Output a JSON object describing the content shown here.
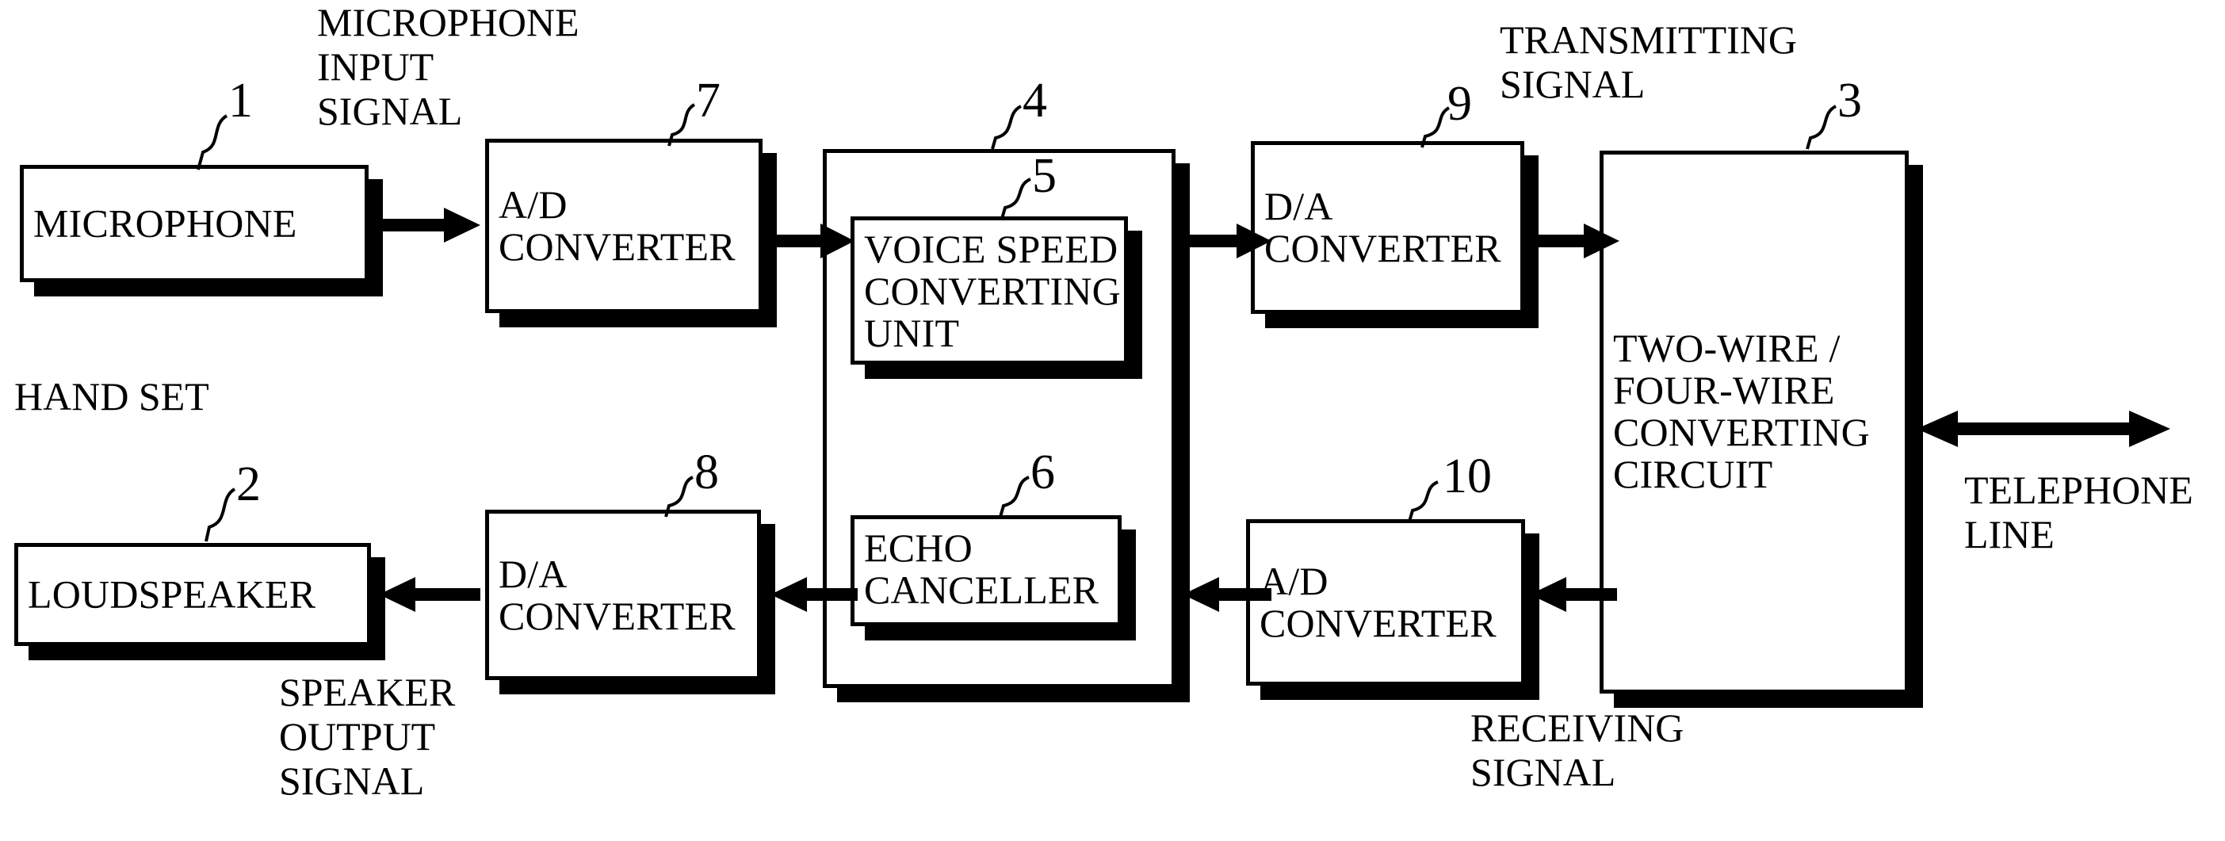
{
  "figure": {
    "type": "patent-block-diagram",
    "blocks": [
      {
        "ref": "1",
        "label": "MICROPHONE"
      },
      {
        "ref": "7",
        "label": "A/D\nCONVERTER"
      },
      {
        "ref": "4",
        "label": ""
      },
      {
        "ref": "5",
        "label": "VOICE SPEED\nCONVERTING\nUNIT"
      },
      {
        "ref": "6",
        "label": "ECHO\nCANCELLER"
      },
      {
        "ref": "9",
        "label": "D/A\nCONVERTER"
      },
      {
        "ref": "3",
        "label": "TWO-WIRE /\nFOUR-WIRE\nCONVERTING\nCIRCUIT"
      },
      {
        "ref": "2",
        "label": "LOUDSPEAKER"
      },
      {
        "ref": "8",
        "label": "D/A\nCONVERTER"
      },
      {
        "ref": "10",
        "label": "A/D\nCONVERTER"
      }
    ],
    "annotations": [
      {
        "id": "microphone-input-signal",
        "text": "MICROPHONE\nINPUT\nSIGNAL"
      },
      {
        "id": "hand-set",
        "text": "HAND SET"
      },
      {
        "id": "transmitting-signal",
        "text": "TRANSMITTING\nSIGNAL"
      },
      {
        "id": "telephone-line",
        "text": "TELEPHONE\nLINE"
      },
      {
        "id": "speaker-output-signal",
        "text": "SPEAKER\nOUTPUT\nSIGNAL"
      },
      {
        "id": "receiving-signal",
        "text": "RECEIVING\nSIGNAL"
      }
    ],
    "colors": {
      "ink": "#000000",
      "paper": "#ffffff"
    }
  }
}
